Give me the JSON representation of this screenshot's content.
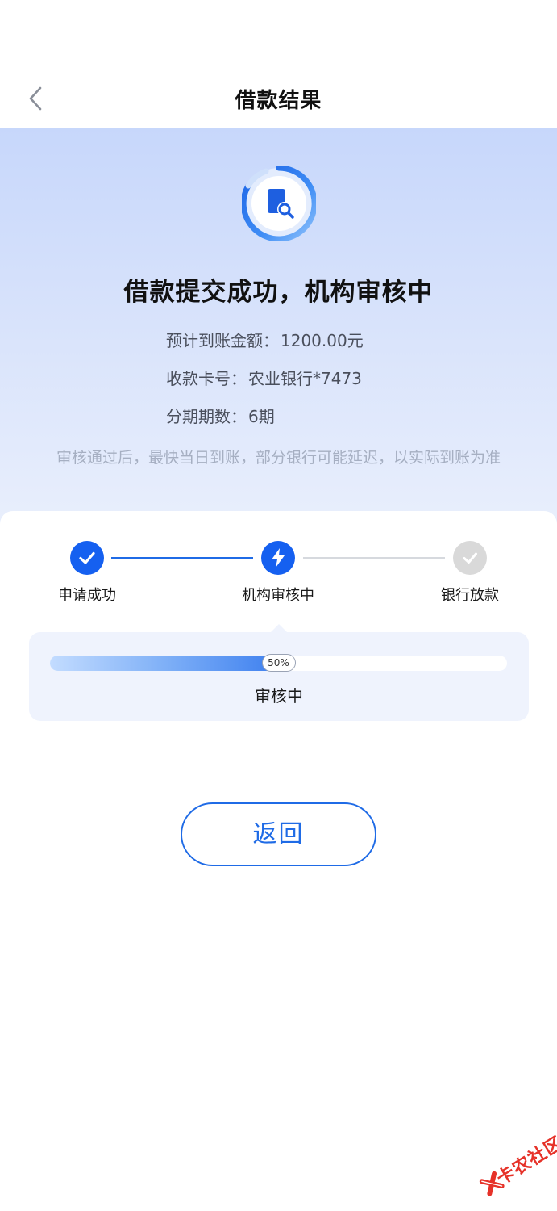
{
  "header": {
    "title": "借款结果",
    "back_icon": "chevron-left-icon"
  },
  "hero": {
    "icon": "document-search-icon",
    "status_title": "借款提交成功，机构审核中",
    "info": [
      {
        "label": "预计到账金额：",
        "value": "1200.00元"
      },
      {
        "label": "收款卡号：",
        "value": "农业银行*7473"
      },
      {
        "label": "分期期数：",
        "value": "6期"
      }
    ],
    "notice": "审核通过后，最快当日到账，部分银行可能延迟，以实际到账为准"
  },
  "steps": [
    {
      "label": "申请成功",
      "state": "done",
      "icon": "checkmark-icon"
    },
    {
      "label": "机构审核中",
      "state": "active",
      "icon": "lightning-icon"
    },
    {
      "label": "银行放款",
      "state": "pending",
      "icon": "checkmark-icon"
    }
  ],
  "progress": {
    "percent": 50,
    "badge": "50%",
    "status_text": "审核中"
  },
  "actions": {
    "return_label": "返回"
  },
  "watermark": {
    "text": "卡农社区",
    "icon": "kanong-logo-icon"
  },
  "colors": {
    "accent": "#1f6be6",
    "done": "#1560f0",
    "pending": "#d9d9d9",
    "notice": "#a6afc2"
  }
}
